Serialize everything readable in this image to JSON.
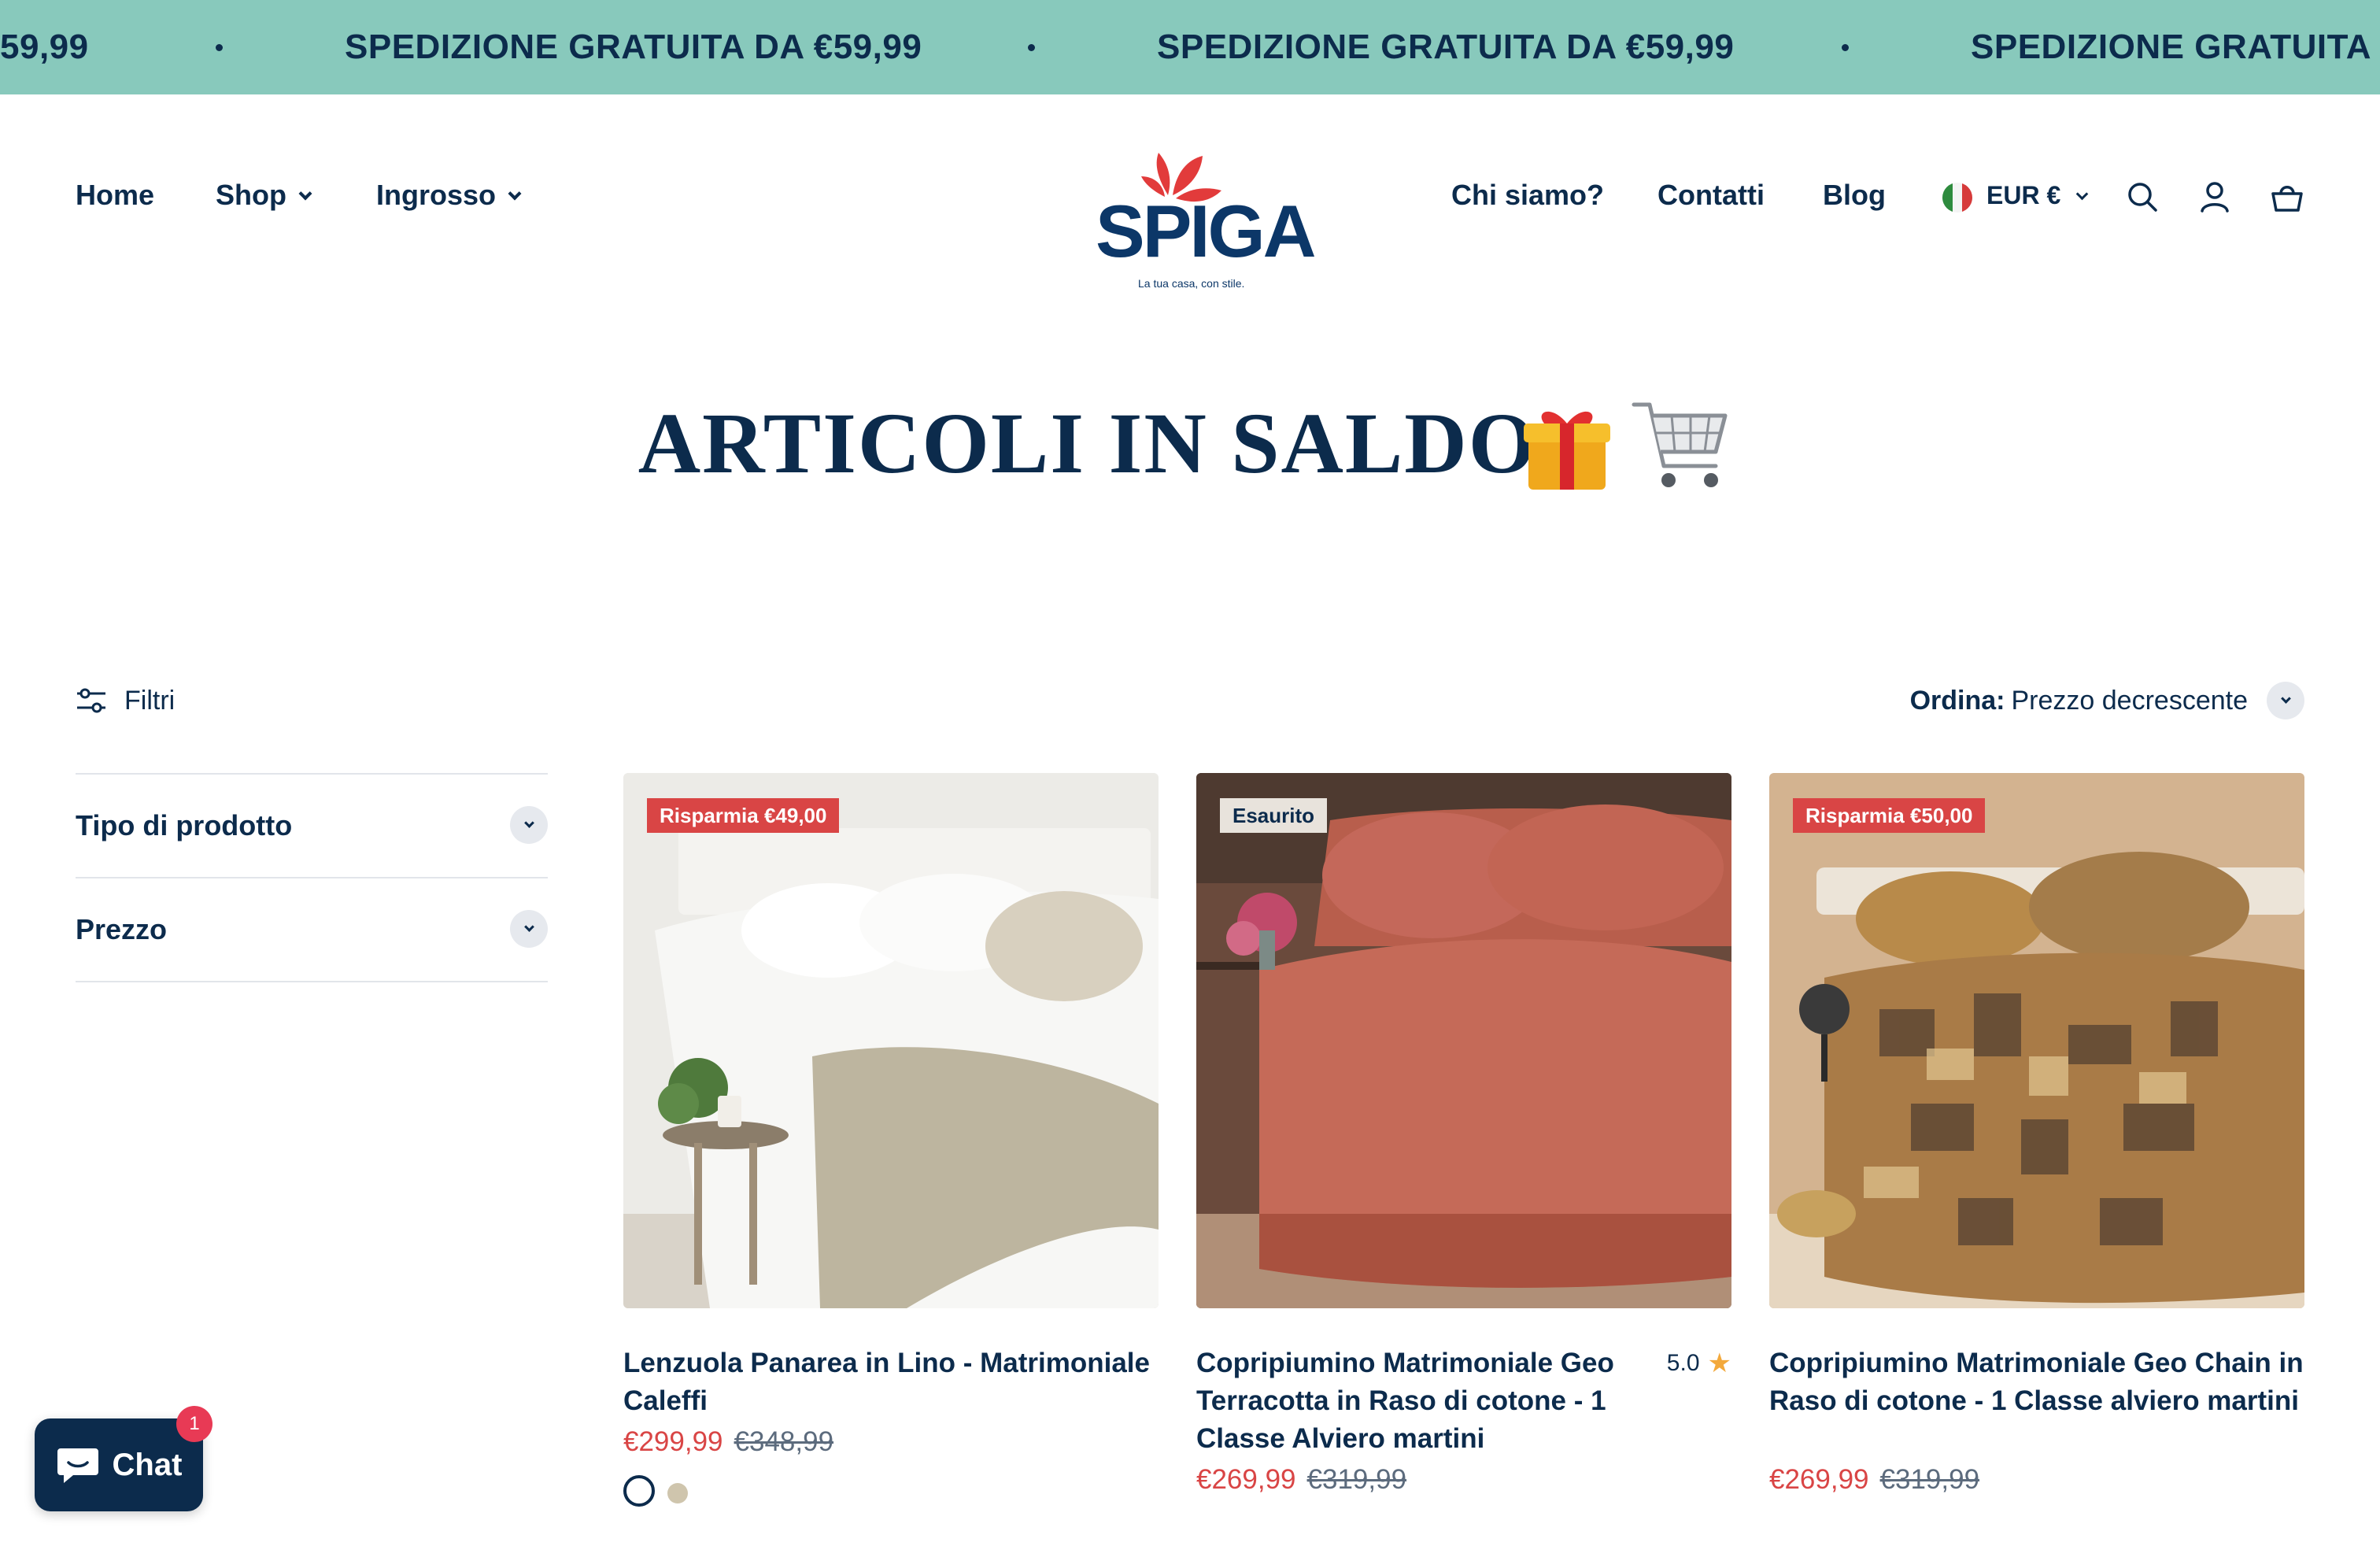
{
  "announcement": {
    "text": "SPEDIZIONE GRATUITA DA €59,99",
    "fragment_start": "59,99",
    "fragment_end": "SPEDIZIONE GRATUITA DA"
  },
  "header": {
    "nav_left": [
      {
        "label": "Home"
      },
      {
        "label": "Shop"
      },
      {
        "label": "Ingrosso"
      }
    ],
    "logo": {
      "word": "SPIGA",
      "tagline": "La tua casa, con stile."
    },
    "nav_right": [
      {
        "label": "Chi siamo?"
      },
      {
        "label": "Contatti"
      },
      {
        "label": "Blog"
      }
    ],
    "currency": "EUR €",
    "icons": [
      "search-icon",
      "account-icon",
      "cart-icon"
    ]
  },
  "page": {
    "title": "ARTICOLI IN SALDO"
  },
  "toolbar": {
    "filters_label": "Filtri",
    "sort_label": "Ordina:",
    "sort_value": "Prezzo decrescente"
  },
  "facets": [
    {
      "label": "Tipo di prodotto"
    },
    {
      "label": "Prezzo"
    }
  ],
  "products": [
    {
      "badge": "Risparmia €49,00",
      "title": "Lenzuola Panarea in Lino - Matrimoniale Caleffi",
      "sale_price": "€299,99",
      "old_price": "€348,99"
    },
    {
      "badge": "Esaurito",
      "title": "Copripiumino Matrimoniale Geo Terracotta in Raso di cotone - 1 Classe Alviero martini",
      "rating": "5.0",
      "sale_price": "€269,99",
      "old_price": "€319,99"
    },
    {
      "badge": "Risparmia €50,00",
      "title": "Copripiumino Matrimoniale Geo Chain in Raso di cotone - 1 Classe alviero martini",
      "sale_price": "€269,99",
      "old_price": "€319,99"
    }
  ],
  "chat": {
    "label": "Chat",
    "count": "1"
  },
  "colors": {
    "announcement_bg": "#88c9bc",
    "navy": "#0c2b4c",
    "sale_red": "#d94545"
  }
}
